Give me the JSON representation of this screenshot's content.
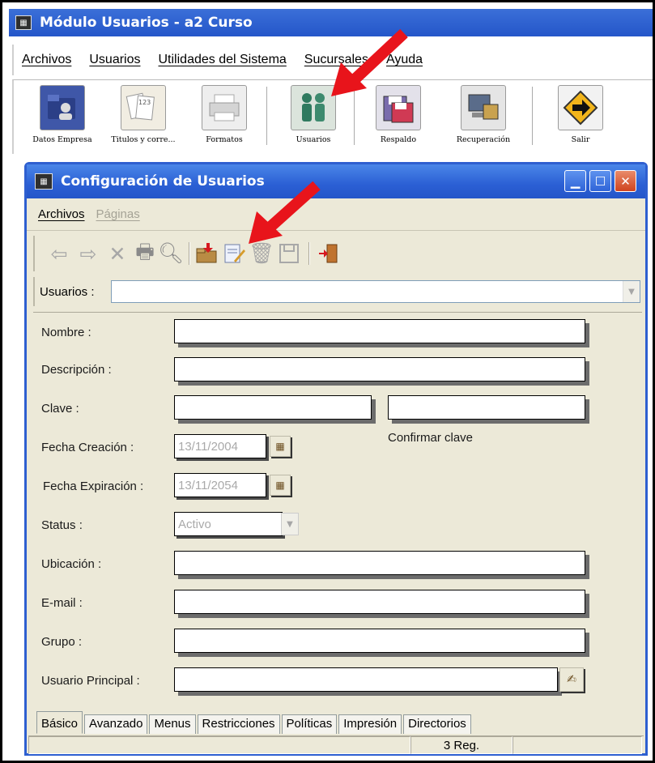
{
  "main_window": {
    "title": "Módulo Usuarios - a2 Curso",
    "menu": [
      "Archivos",
      "Usuarios",
      "Utilidades del Sistema",
      "Sucursales",
      "Ayuda"
    ],
    "toolbar": [
      {
        "label": "Datos Empresa",
        "icon": "company-data-icon"
      },
      {
        "label": "Titulos y corre...",
        "icon": "titles-icon"
      },
      {
        "label": "Formatos",
        "icon": "printer-icon"
      },
      {
        "label": "Usuarios",
        "icon": "users-icon"
      },
      {
        "label": "Respaldo",
        "icon": "backup-disk-icon"
      },
      {
        "label": "Recuperación",
        "icon": "recovery-icon"
      },
      {
        "label": "Salir",
        "icon": "exit-sign-icon"
      }
    ]
  },
  "config_window": {
    "title": "Configuración de Usuarios",
    "menu": {
      "archivos": "Archivos",
      "paginas": "Páginas"
    },
    "usuarios_label": "Usuarios :",
    "usuarios_value": "",
    "form": {
      "nombre_label": "Nombre :",
      "descripcion_label": "Descripción :",
      "clave_label": "Clave :",
      "confirmar_label": "Confirmar clave",
      "fecha_creacion_label": "Fecha Creación :",
      "fecha_creacion_value": "13/11/2004",
      "fecha_expiracion_label": "Fecha Expiración :",
      "fecha_expiracion_value": "13/11/2054",
      "status_label": "Status :",
      "status_value": "Activo",
      "ubicacion_label": "Ubicación :",
      "email_label": "E-mail :",
      "grupo_label": "Grupo :",
      "usuario_principal_label": "Usuario Principal :"
    },
    "tabs": [
      "Básico",
      "Avanzado",
      "Menus",
      "Restricciones",
      "Políticas",
      "Impresión",
      "Directorios"
    ],
    "status_bar": {
      "records": "3 Reg."
    }
  },
  "colors": {
    "titlebar_blue": "#2456c9",
    "window_face": "#ece9d8",
    "annotation_red": "#e8141b"
  }
}
